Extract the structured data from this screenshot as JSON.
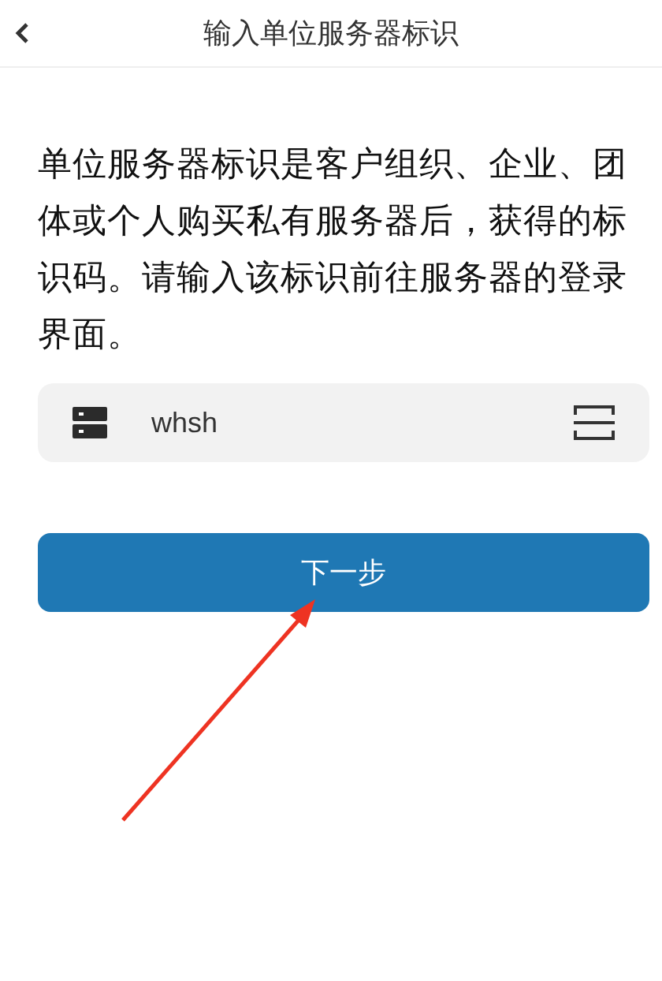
{
  "header": {
    "title": "输入单位服务器标识"
  },
  "description": "单位服务器标识是客户组织、企业、团体或个人购买私有服务器后，获得的标识码。请输入该标识前往服务器的登录界面。",
  "server_field": {
    "value": "whsh"
  },
  "next_button": {
    "label": "下一步"
  }
}
